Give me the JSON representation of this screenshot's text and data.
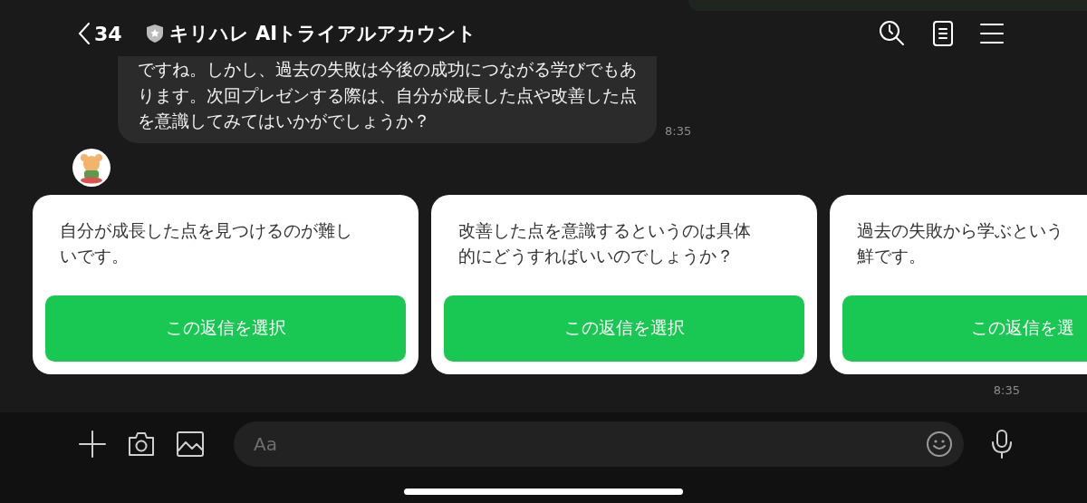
{
  "header": {
    "back_count": "34",
    "title": "キリハレ AIトライアルアカウント"
  },
  "message": {
    "lines": [
      "ですね。しかし、過去の失敗は今後の成功につながる学びでもあ",
      "ります。次回プレゼンする際は、自分が成長した点や改善した点",
      "を意識してみてはいかがでしょうか？"
    ],
    "time": "8:35"
  },
  "reply_cards": [
    {
      "lines": [
        "自分が成長した点を見つけるのが難し",
        "いです。"
      ],
      "button": "この返信を選択"
    },
    {
      "lines": [
        "改善した点を意識するというのは具体",
        "的にどうすればいいのでしょうか？"
      ],
      "button": "この返信を選択"
    },
    {
      "lines": [
        "過去の失敗から学ぶという",
        "鮮です。"
      ],
      "button": "この返信を選"
    }
  ],
  "cards_time": "8:35",
  "input": {
    "placeholder": "Aa"
  }
}
